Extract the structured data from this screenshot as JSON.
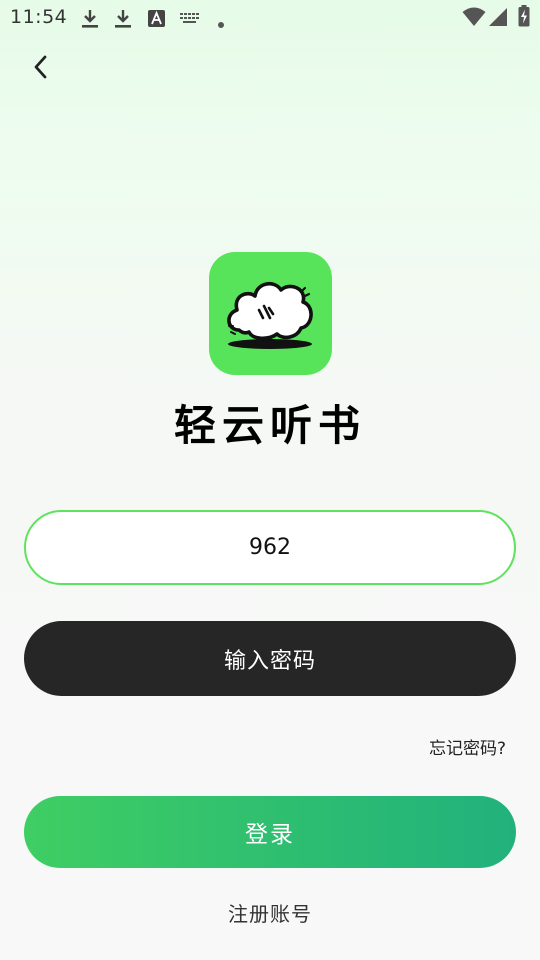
{
  "status_bar": {
    "time": "11:54",
    "icons": [
      "download-icon",
      "download-icon",
      "font-a-icon",
      "keyboard-icon",
      "dot-icon",
      "wifi-icon",
      "signal-icon",
      "battery-charging-icon"
    ]
  },
  "nav": {
    "back_icon": "chevron-left-icon"
  },
  "app": {
    "logo_icon": "cloud-logo-icon",
    "title": "轻云听书",
    "logo_color": "#58e45a"
  },
  "form": {
    "phone_value": "962",
    "password_label": "输入密码",
    "forgot_label": "忘记密码?",
    "login_label": "登录",
    "register_label": "注册账号"
  },
  "colors": {
    "accent_green": "#5fe25d",
    "dark_button": "#262626",
    "login_gradient_start": "#3fce63",
    "login_gradient_end": "#22b17c"
  }
}
